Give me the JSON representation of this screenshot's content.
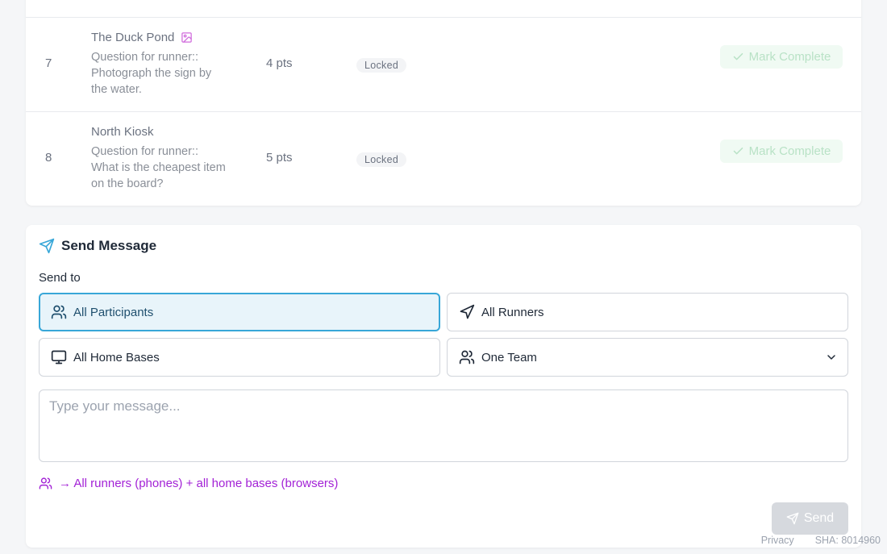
{
  "stops": [
    {
      "number": "7",
      "name": "The Duck Pond",
      "has_image_icon": true,
      "question": "Question for runner:: Photograph the sign by the water.",
      "points": "4 pts",
      "status": "Locked",
      "action": "Mark Complete"
    },
    {
      "number": "8",
      "name": "North Kiosk",
      "has_image_icon": false,
      "question": "Question for runner:: What is the cheapest item on the board?",
      "points": "5 pts",
      "status": "Locked",
      "action": "Mark Complete"
    }
  ],
  "message": {
    "title": "Send Message",
    "send_to_label": "Send to",
    "options": {
      "all_participants": "All Participants",
      "all_runners": "All Runners",
      "all_home_bases": "All Home Bases",
      "one_team": "One Team"
    },
    "selected_option": "All Participants",
    "placeholder": "Type your message...",
    "hint": "→ All runners (phones) + all home bases (browsers)",
    "send_label": "Send"
  },
  "footer": {
    "privacy": "Privacy",
    "sha": "SHA: 8014960"
  },
  "colors": {
    "selected_border": "#38a7d8",
    "selected_bg": "#e8f4fa",
    "hint": "#a322d6",
    "mark_complete_text": "#b9e2c6",
    "image_icon": "#d06bdc"
  }
}
